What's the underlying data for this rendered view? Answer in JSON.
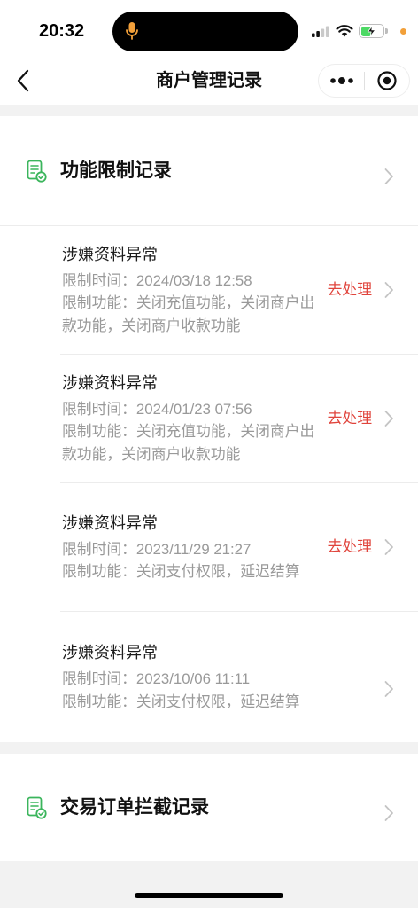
{
  "status_bar": {
    "time": "20:32",
    "mic_icon": "microphone-icon",
    "signal_icon": "cellular-signal-icon",
    "wifi_icon": "wifi-icon",
    "battery_icon": "battery-charging-icon",
    "battery_level": 0.5,
    "battery_charging": true,
    "privacy_indicator": "orange-dot"
  },
  "nav": {
    "title": "商户管理记录",
    "back_icon": "chevron-left-icon",
    "menu_icon": "more-dots-icon",
    "close_icon": "target-circle-icon"
  },
  "sections": [
    {
      "title": "功能限制记录",
      "icon": "record-document-check-icon",
      "chevron_icon": "chevron-right-icon",
      "records": [
        {
          "title": "涉嫌资料异常",
          "time_label": "限制时间：",
          "time": "2024/03/18 12:58",
          "func_label": "限制功能：",
          "functions": "关闭充值功能，关闭商户出款功能，关闭商户收款功能",
          "action": "去处理"
        },
        {
          "title": "涉嫌资料异常",
          "time_label": "限制时间：",
          "time": "2024/01/23 07:56",
          "func_label": "限制功能：",
          "functions": "关闭充值功能，关闭商户出款功能，关闭商户收款功能",
          "action": "去处理"
        },
        {
          "title": "涉嫌资料异常",
          "time_label": "限制时间：",
          "time": "2023/11/29 21:27",
          "func_label": "限制功能：",
          "functions": "关闭支付权限，延迟结算",
          "action": "去处理"
        },
        {
          "title": "涉嫌资料异常",
          "time_label": "限制时间：",
          "time": "2023/10/06 11:11",
          "func_label": "限制功能：",
          "functions": "关闭支付权限，延迟结算"
        }
      ]
    },
    {
      "title": "交易订单拦截记录",
      "icon": "record-document-check-icon",
      "chevron_icon": "chevron-right-icon"
    }
  ],
  "colors": {
    "accent_green": "#3bb55c",
    "action_red": "#e0443c",
    "recording_orange": "#f2a03a",
    "battery_green": "#4cd964",
    "page_background": "#f2f2f2"
  }
}
